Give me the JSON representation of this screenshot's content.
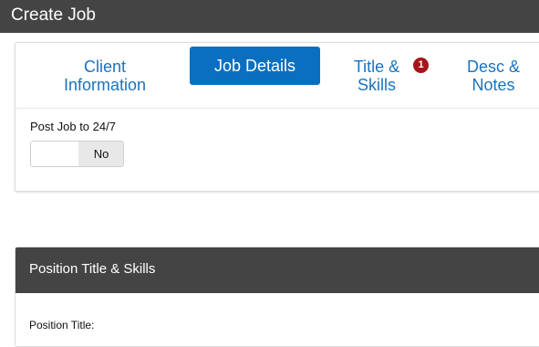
{
  "window": {
    "title": "Create Job"
  },
  "tabs": [
    {
      "line1": "Client",
      "line2": "Information",
      "selected": false
    },
    {
      "label": "Job Details",
      "selected": true
    },
    {
      "line1": "Title &",
      "line2": "Skills",
      "selected": false,
      "badge": "1"
    },
    {
      "line1": "Desc &",
      "line2": "Notes",
      "selected": false
    }
  ],
  "post_job": {
    "label": "Post Job to 24/7",
    "value": "No"
  },
  "position_section": {
    "title": "Position Title & Skills",
    "position_title_label": "Position Title:"
  },
  "colors": {
    "header_bg": "#444444",
    "tab_text": "#1a73be",
    "tab_selected_bg": "#0b6fc0",
    "badge_bg": "#a8141a"
  }
}
